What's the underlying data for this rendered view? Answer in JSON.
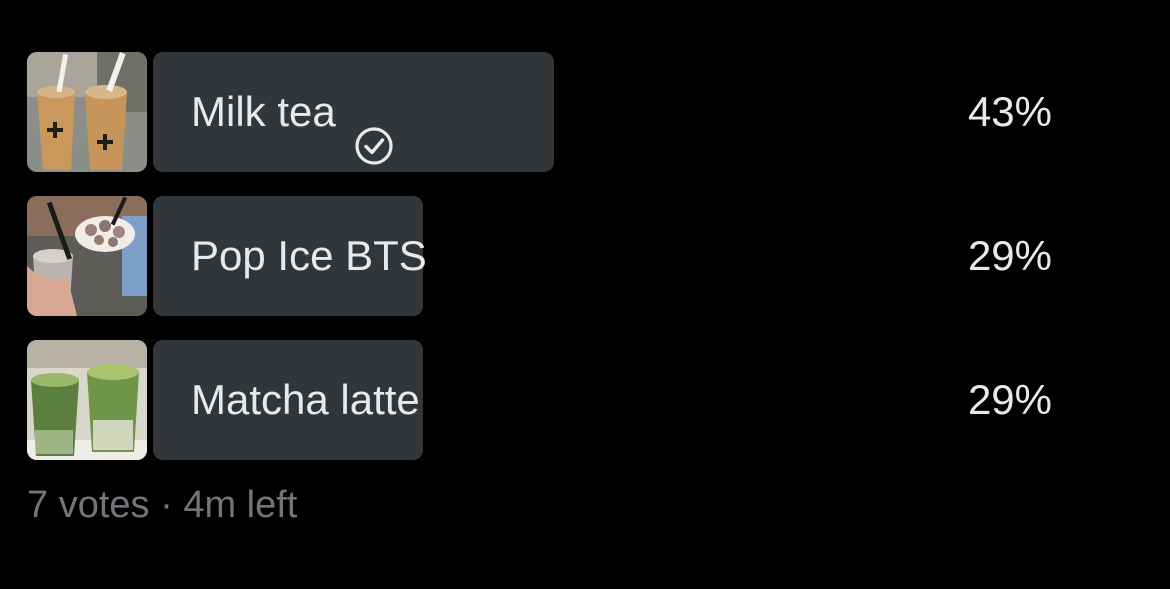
{
  "poll": {
    "options": [
      {
        "label": "Milk tea",
        "percent": "43%",
        "share": 0.43,
        "selected": true,
        "image": "milk-tea-photo"
      },
      {
        "label": "Pop Ice BTS",
        "percent": "29%",
        "share": 0.29,
        "selected": false,
        "image": "pop-ice-photo"
      },
      {
        "label": "Matcha latte",
        "percent": "29%",
        "share": 0.29,
        "selected": false,
        "image": "matcha-latte-photo"
      }
    ],
    "votes": "7 votes",
    "separator": "·",
    "time_left": "4m left"
  },
  "colors": {
    "background": "#000000",
    "bar": "#333639",
    "text": "#e7e9ea",
    "muted": "#71767b"
  },
  "icons": {
    "selected_check": "check-circle-icon"
  }
}
